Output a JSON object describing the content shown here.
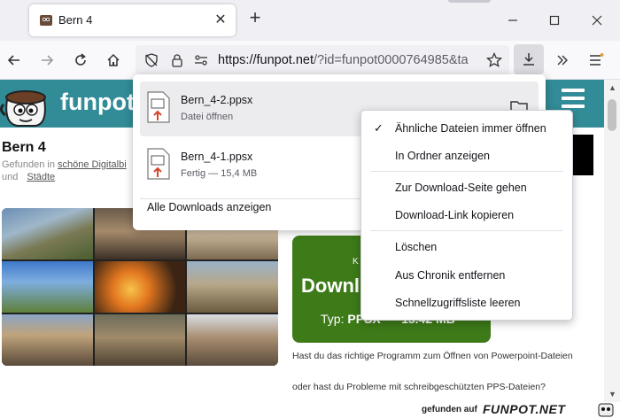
{
  "tab": {
    "title": "Bern 4"
  },
  "window": {
    "minimize": "—",
    "maximize": "☐",
    "close": "✕"
  },
  "navbar": {
    "url_domain": "https://funpot.net",
    "url_rest": "/?id=funpot0000764985&ta"
  },
  "page": {
    "logo_text": "funpot",
    "title": "Bern 4",
    "found_prefix": "Gefunden in",
    "found_link": "schöne Digitalbi",
    "found_and": "und",
    "found_link2": "Städte",
    "ad_text": "er",
    "download_k": "K",
    "download_big": "Downl",
    "download_type_prefix": "Typ:",
    "download_type": "PPSX",
    "download_size": "15.42 MB",
    "desc_line1": "Hast du das richtige Programm zum Öffnen von Powerpoint-Dateien",
    "desc_line2": "oder hast du Probleme mit schreibgeschützten PPS-Dateien?",
    "footer_text": "gefunden auf",
    "footer_brand": "FUNPOT.NET"
  },
  "downloads": {
    "items": [
      {
        "name": "Bern_4-2.ppsx",
        "status": "Datei öffnen"
      },
      {
        "name": "Bern_4-1.ppsx",
        "status": "Fertig — 15,4 MB"
      }
    ],
    "show_all": "Alle Downloads anzeigen"
  },
  "context_menu": {
    "items": [
      {
        "label": "Ähnliche Dateien immer öffnen",
        "checked": true
      },
      {
        "label": "In Ordner anzeigen"
      },
      {
        "label": "Zur Download-Seite gehen"
      },
      {
        "label": "Download-Link kopieren"
      },
      {
        "label": "Löschen"
      },
      {
        "label": "Aus Chronik entfernen"
      },
      {
        "label": "Schnellzugriffsliste leeren"
      }
    ],
    "check_mark": "✓"
  },
  "colors": {
    "header_teal": "#328c97",
    "download_green": "#3d7a18",
    "selected_item": "#ececee"
  }
}
